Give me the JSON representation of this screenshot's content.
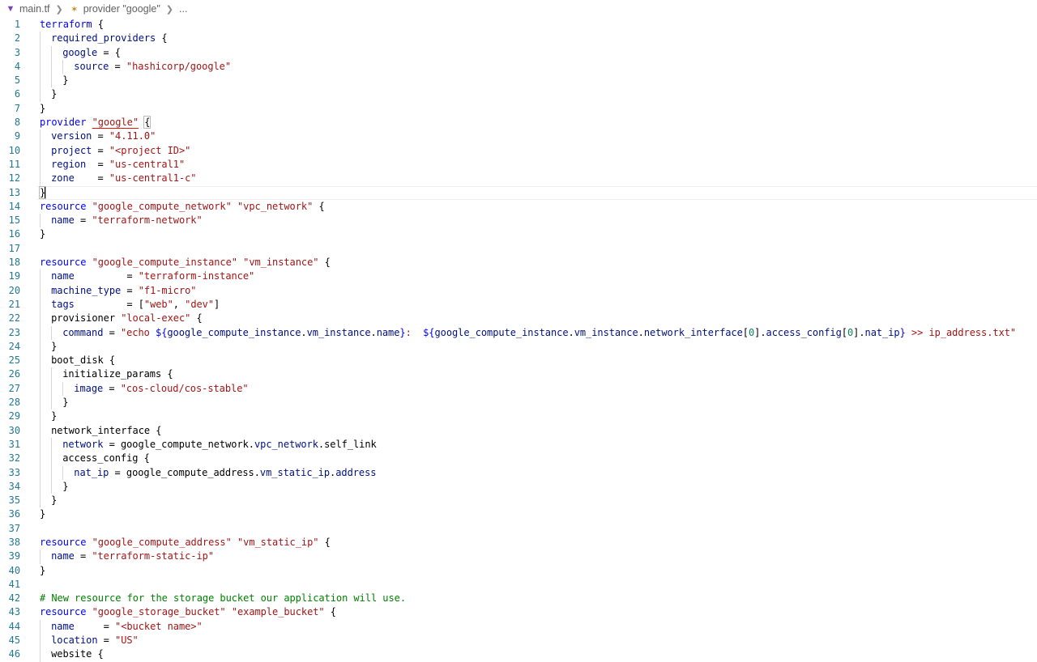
{
  "breadcrumb": {
    "file": "main.tf",
    "symbol": "provider \"google\"",
    "more": "..."
  },
  "lines": [
    {
      "n": "1",
      "g": 0,
      "t": [
        [
          "kw",
          "terraform"
        ],
        [
          "pl",
          " {"
        ]
      ]
    },
    {
      "n": "2",
      "g": 1,
      "t": [
        [
          "id",
          "required_providers"
        ],
        [
          "pl",
          " {"
        ]
      ]
    },
    {
      "n": "3",
      "g": 2,
      "t": [
        [
          "id",
          "google"
        ],
        [
          "pl",
          " = {"
        ]
      ]
    },
    {
      "n": "4",
      "g": 3,
      "t": [
        [
          "id",
          "source"
        ],
        [
          "pl",
          " = "
        ],
        [
          "str",
          "\"hashicorp/google\""
        ]
      ]
    },
    {
      "n": "5",
      "g": 2,
      "t": [
        [
          "pl",
          "}"
        ]
      ]
    },
    {
      "n": "6",
      "g": 1,
      "t": [
        [
          "pl",
          "}"
        ]
      ]
    },
    {
      "n": "7",
      "g": 0,
      "t": [
        [
          "pl",
          "}"
        ]
      ]
    },
    {
      "n": "8",
      "g": 0,
      "t": [
        [
          "kw",
          "provider"
        ],
        [
          "pl",
          " "
        ],
        [
          "str",
          "\"google\"",
          "squiggle"
        ],
        [
          "pl",
          " "
        ],
        [
          "pl",
          "{",
          "bracket-match"
        ]
      ]
    },
    {
      "n": "9",
      "g": 1,
      "t": [
        [
          "id",
          "version"
        ],
        [
          "pl",
          " = "
        ],
        [
          "str",
          "\"4.11.0\""
        ]
      ]
    },
    {
      "n": "10",
      "g": 1,
      "t": [
        [
          "id",
          "project"
        ],
        [
          "pl",
          " = "
        ],
        [
          "str",
          "\"<project ID>\""
        ]
      ]
    },
    {
      "n": "11",
      "g": 1,
      "t": [
        [
          "id",
          "region"
        ],
        [
          "pl",
          "  = "
        ],
        [
          "str",
          "\"us-central1\""
        ]
      ]
    },
    {
      "n": "12",
      "g": 1,
      "t": [
        [
          "id",
          "zone"
        ],
        [
          "pl",
          "    = "
        ],
        [
          "str",
          "\"us-central1-c\""
        ]
      ]
    },
    {
      "n": "13",
      "g": 0,
      "cur": true,
      "t": [
        [
          "pl",
          "}",
          "bracket-match"
        ],
        [
          "pl",
          "",
          "cursor"
        ]
      ]
    },
    {
      "n": "14",
      "g": 0,
      "t": [
        [
          "kw",
          "resource"
        ],
        [
          "pl",
          " "
        ],
        [
          "str",
          "\"google_compute_network\""
        ],
        [
          "pl",
          " "
        ],
        [
          "str",
          "\"vpc_network\""
        ],
        [
          "pl",
          " {"
        ]
      ]
    },
    {
      "n": "15",
      "g": 1,
      "t": [
        [
          "id",
          "name"
        ],
        [
          "pl",
          " = "
        ],
        [
          "str",
          "\"terraform-network\""
        ]
      ]
    },
    {
      "n": "16",
      "g": 0,
      "t": [
        [
          "pl",
          "}"
        ]
      ]
    },
    {
      "n": "17",
      "g": 0,
      "t": []
    },
    {
      "n": "18",
      "g": 0,
      "t": [
        [
          "kw",
          "resource"
        ],
        [
          "pl",
          " "
        ],
        [
          "str",
          "\"google_compute_instance\""
        ],
        [
          "pl",
          " "
        ],
        [
          "str",
          "\"vm_instance\""
        ],
        [
          "pl",
          " {"
        ]
      ]
    },
    {
      "n": "19",
      "g": 1,
      "t": [
        [
          "id",
          "name"
        ],
        [
          "pl",
          "         = "
        ],
        [
          "str",
          "\"terraform-instance\""
        ]
      ]
    },
    {
      "n": "20",
      "g": 1,
      "t": [
        [
          "id",
          "machine_type"
        ],
        [
          "pl",
          " = "
        ],
        [
          "str",
          "\"f1-micro\""
        ]
      ]
    },
    {
      "n": "21",
      "g": 1,
      "t": [
        [
          "id",
          "tags"
        ],
        [
          "pl",
          "         = ["
        ],
        [
          "str",
          "\"web\""
        ],
        [
          "pl",
          ", "
        ],
        [
          "str",
          "\"dev\""
        ],
        [
          "pl",
          "]"
        ]
      ]
    },
    {
      "n": "22",
      "g": 1,
      "t": [
        [
          "pl",
          "provisioner "
        ],
        [
          "str",
          "\"local-exec\""
        ],
        [
          "pl",
          " {"
        ]
      ]
    },
    {
      "n": "23",
      "g": 2,
      "t": [
        [
          "id",
          "command"
        ],
        [
          "pl",
          " = "
        ],
        [
          "str",
          "\"echo "
        ],
        [
          "kw",
          "${"
        ],
        [
          "id",
          "google_compute_instance"
        ],
        [
          "pl",
          "."
        ],
        [
          "id",
          "vm_instance"
        ],
        [
          "pl",
          "."
        ],
        [
          "id",
          "name"
        ],
        [
          "kw",
          "}"
        ],
        [
          "str",
          ":  "
        ],
        [
          "kw",
          "${"
        ],
        [
          "id",
          "google_compute_instance"
        ],
        [
          "pl",
          "."
        ],
        [
          "id",
          "vm_instance"
        ],
        [
          "pl",
          "."
        ],
        [
          "id",
          "network_interface"
        ],
        [
          "pl",
          "["
        ],
        [
          "num",
          "0"
        ],
        [
          "pl",
          "]."
        ],
        [
          "id",
          "access_config"
        ],
        [
          "pl",
          "["
        ],
        [
          "num",
          "0"
        ],
        [
          "pl",
          "]."
        ],
        [
          "id",
          "nat_ip"
        ],
        [
          "kw",
          "}"
        ],
        [
          "str",
          " >> ip_address.txt\""
        ]
      ]
    },
    {
      "n": "24",
      "g": 1,
      "t": [
        [
          "pl",
          "}"
        ]
      ]
    },
    {
      "n": "25",
      "g": 1,
      "t": [
        [
          "pl",
          "boot_disk {"
        ]
      ]
    },
    {
      "n": "26",
      "g": 2,
      "t": [
        [
          "pl",
          "initialize_params {"
        ]
      ]
    },
    {
      "n": "27",
      "g": 3,
      "t": [
        [
          "id",
          "image"
        ],
        [
          "pl",
          " = "
        ],
        [
          "str",
          "\"cos-cloud/cos-stable\""
        ]
      ]
    },
    {
      "n": "28",
      "g": 2,
      "t": [
        [
          "pl",
          "}"
        ]
      ]
    },
    {
      "n": "29",
      "g": 1,
      "t": [
        [
          "pl",
          "}"
        ]
      ]
    },
    {
      "n": "30",
      "g": 1,
      "t": [
        [
          "pl",
          "network_interface {"
        ]
      ]
    },
    {
      "n": "31",
      "g": 2,
      "t": [
        [
          "id",
          "network"
        ],
        [
          "pl",
          " = "
        ],
        [
          "pl",
          "google_compute_network"
        ],
        [
          "pl",
          "."
        ],
        [
          "id",
          "vpc_network"
        ],
        [
          "pl",
          "."
        ],
        [
          "pl",
          "self_link"
        ]
      ]
    },
    {
      "n": "32",
      "g": 2,
      "t": [
        [
          "pl",
          "access_config {"
        ]
      ]
    },
    {
      "n": "33",
      "g": 3,
      "t": [
        [
          "id",
          "nat_ip"
        ],
        [
          "pl",
          " = "
        ],
        [
          "pl",
          "google_compute_address"
        ],
        [
          "pl",
          "."
        ],
        [
          "id",
          "vm_static_ip"
        ],
        [
          "pl",
          "."
        ],
        [
          "id",
          "address"
        ]
      ]
    },
    {
      "n": "34",
      "g": 2,
      "t": [
        [
          "pl",
          "}"
        ]
      ]
    },
    {
      "n": "35",
      "g": 1,
      "t": [
        [
          "pl",
          "}"
        ]
      ]
    },
    {
      "n": "36",
      "g": 0,
      "t": [
        [
          "pl",
          "}"
        ]
      ]
    },
    {
      "n": "37",
      "g": 0,
      "t": []
    },
    {
      "n": "38",
      "g": 0,
      "t": [
        [
          "kw",
          "resource"
        ],
        [
          "pl",
          " "
        ],
        [
          "str",
          "\"google_compute_address\""
        ],
        [
          "pl",
          " "
        ],
        [
          "str",
          "\"vm_static_ip\""
        ],
        [
          "pl",
          " {"
        ]
      ]
    },
    {
      "n": "39",
      "g": 1,
      "t": [
        [
          "id",
          "name"
        ],
        [
          "pl",
          " = "
        ],
        [
          "str",
          "\"terraform-static-ip\""
        ]
      ]
    },
    {
      "n": "40",
      "g": 0,
      "t": [
        [
          "pl",
          "}"
        ]
      ]
    },
    {
      "n": "41",
      "g": 0,
      "t": []
    },
    {
      "n": "42",
      "g": 0,
      "t": [
        [
          "cm",
          "# New resource for the storage bucket our application will use."
        ]
      ]
    },
    {
      "n": "43",
      "g": 0,
      "t": [
        [
          "kw",
          "resource"
        ],
        [
          "pl",
          " "
        ],
        [
          "str",
          "\"google_storage_bucket\""
        ],
        [
          "pl",
          " "
        ],
        [
          "str",
          "\"example_bucket\""
        ],
        [
          "pl",
          " {"
        ]
      ]
    },
    {
      "n": "44",
      "g": 1,
      "t": [
        [
          "id",
          "name"
        ],
        [
          "pl",
          "     = "
        ],
        [
          "str",
          "\"<bucket name>\""
        ]
      ]
    },
    {
      "n": "45",
      "g": 1,
      "t": [
        [
          "id",
          "location"
        ],
        [
          "pl",
          " = "
        ],
        [
          "str",
          "\"US\""
        ]
      ]
    },
    {
      "n": "46",
      "g": 1,
      "t": [
        [
          "pl",
          "website {"
        ]
      ]
    }
  ]
}
